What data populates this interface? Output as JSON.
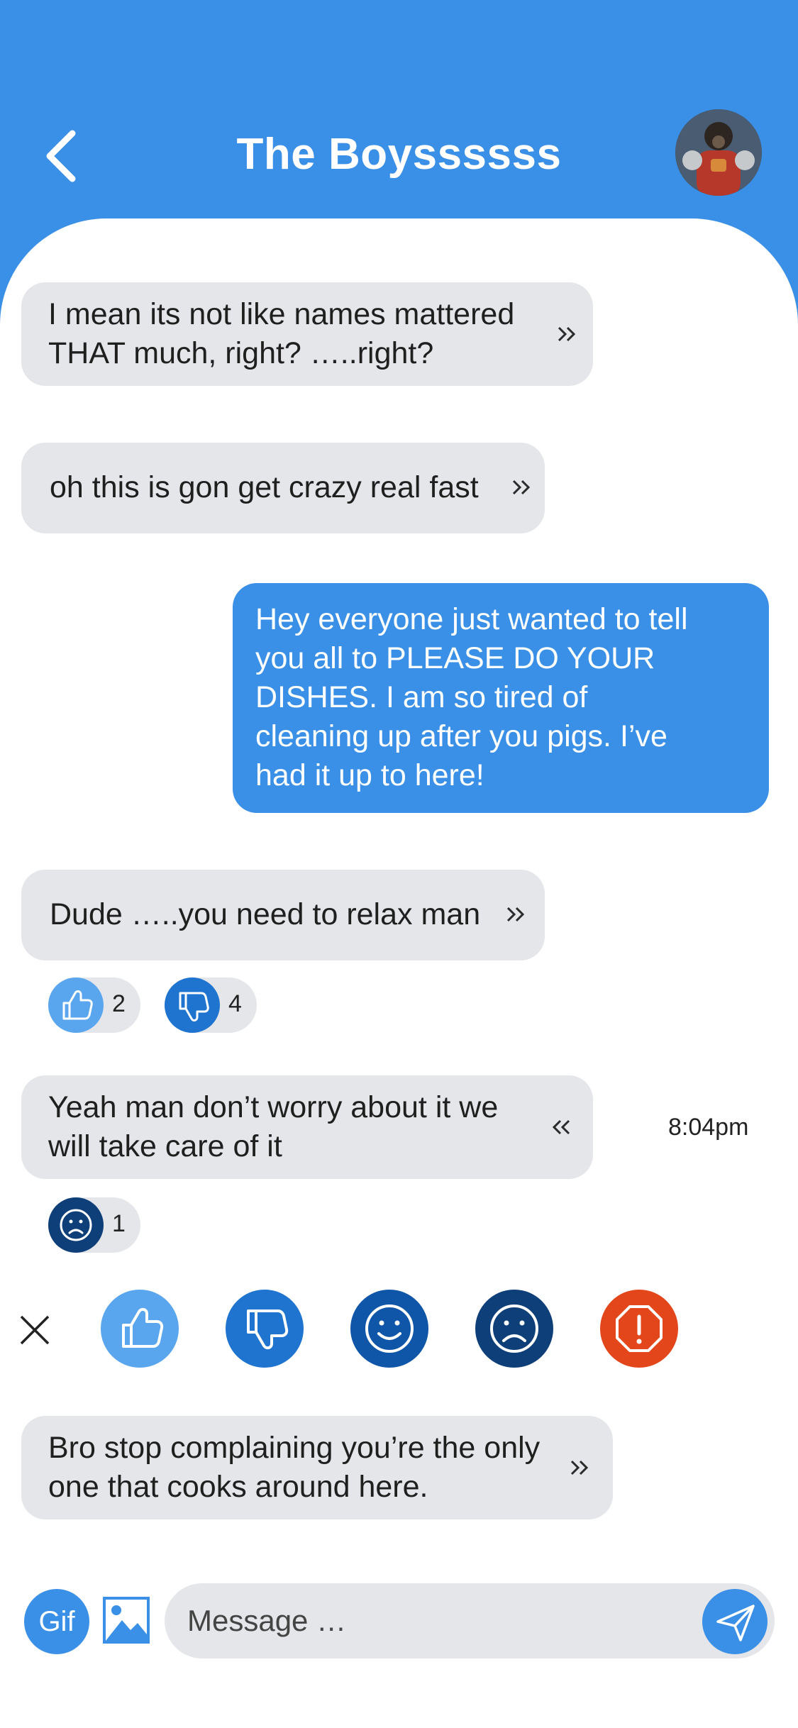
{
  "header": {
    "title": "The Boyssssss",
    "back_icon": "chevron-left-icon"
  },
  "messages": [
    {
      "side": "in",
      "text_lines": [
        "I mean its not like names mattered",
        "THAT much, right? …..right?"
      ],
      "icon": "double-chevron-right-icon"
    },
    {
      "side": "in",
      "text_lines": [
        "oh this is gon get crazy real fast"
      ],
      "icon": "double-chevron-right-icon"
    },
    {
      "side": "out",
      "text_lines": [
        "Hey everyone just wanted to tell",
        "you all to PLEASE DO YOUR",
        "DISHES. I am so tired of",
        "cleaning up after you pigs. I’ve",
        "had it up to here!"
      ]
    },
    {
      "side": "in",
      "text_lines": [
        "Dude …..you need to relax man"
      ],
      "icon": "double-chevron-right-icon",
      "reactions": [
        {
          "icon": "thumbs-up-icon",
          "count": "2",
          "color": "#5aa6ee"
        },
        {
          "icon": "thumbs-down-icon",
          "count": "4",
          "color": "#1f74d0"
        }
      ]
    },
    {
      "side": "in",
      "text_lines": [
        "Yeah man don’t worry about it we",
        "will take care of it"
      ],
      "icon": "double-chevron-left-icon",
      "timestamp": "8:04pm",
      "reactions": [
        {
          "icon": "frown-icon",
          "count": "1",
          "color": "#0e3f78"
        }
      ]
    },
    {
      "side": "in",
      "text_lines": [
        "Bro stop complaining you’re the only",
        "one that cooks around here."
      ],
      "icon": "double-chevron-right-icon"
    }
  ],
  "reaction_bar": {
    "close_icon": "close-icon",
    "options": [
      {
        "icon": "thumbs-up-icon",
        "color": "#5aa6ee"
      },
      {
        "icon": "thumbs-down-icon",
        "color": "#1f74d0"
      },
      {
        "icon": "smile-icon",
        "color": "#0f55a8"
      },
      {
        "icon": "frown-icon",
        "color": "#0e3f78"
      },
      {
        "icon": "report-icon",
        "color": "#e2461a"
      }
    ]
  },
  "composer": {
    "gif_label": "Gif",
    "placeholder": "Message …",
    "image_icon": "image-icon",
    "send_icon": "send-icon"
  },
  "colors": {
    "accent": "#3a8fe6",
    "incoming_bubble": "#e5e6e9",
    "text": "#1f1f1f"
  }
}
